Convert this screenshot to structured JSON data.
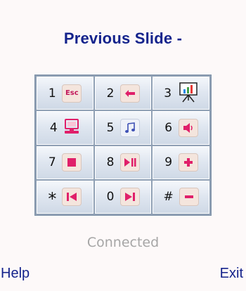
{
  "screen": {
    "title": "Previous Slide -",
    "status": "Connected"
  },
  "keypad": {
    "keys": [
      {
        "label": "1",
        "icon": "esc-icon",
        "icon_text": "Esc"
      },
      {
        "label": "2",
        "icon": "back-arrow-icon"
      },
      {
        "label": "3",
        "icon": "presentation-icon"
      },
      {
        "label": "4",
        "icon": "computer-icon"
      },
      {
        "label": "5",
        "icon": "music-icon"
      },
      {
        "label": "6",
        "icon": "volume-icon"
      },
      {
        "label": "7",
        "icon": "stop-icon"
      },
      {
        "label": "8",
        "icon": "play-pause-icon"
      },
      {
        "label": "9",
        "icon": "plus-icon"
      },
      {
        "label": "*",
        "icon": "previous-track-icon"
      },
      {
        "label": "0",
        "icon": "next-track-icon"
      },
      {
        "label": "#",
        "icon": "minus-icon"
      }
    ]
  },
  "softkeys": {
    "left": "Help",
    "right": "Exit"
  },
  "colors": {
    "accent": "#e0206a",
    "title": "#14238c",
    "status": "#a6a6a6"
  }
}
